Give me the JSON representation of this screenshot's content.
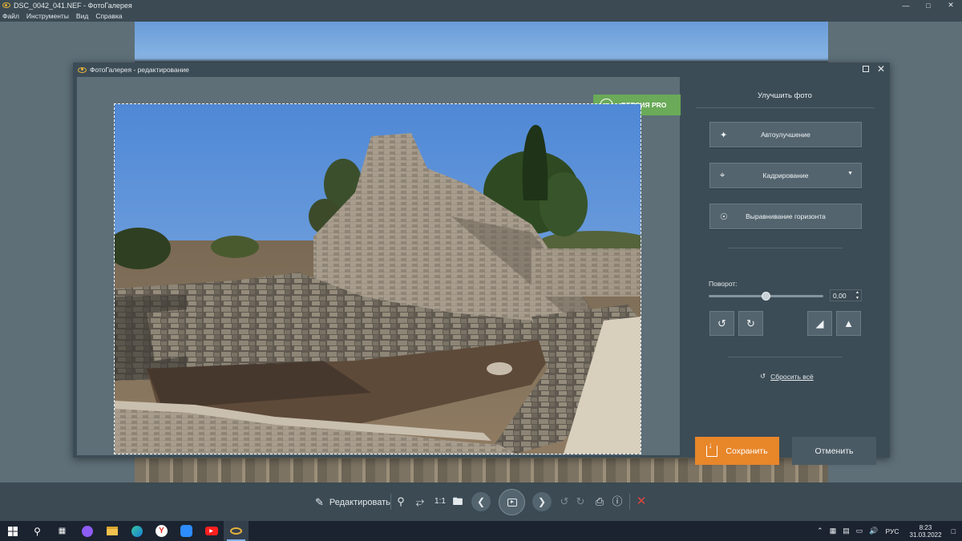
{
  "window": {
    "title": "DSC_0042_041.NEF - ФотоГалерея",
    "menu": [
      "Файл",
      "Инструменты",
      "Вид",
      "Справка"
    ]
  },
  "dialog": {
    "title": "ФотоГалерея - редактирование",
    "pro_badge": "ВЕРСИЯ PRO"
  },
  "panel": {
    "title": "Улучшить фото",
    "auto_enhance": "Автоулучшение",
    "crop": "Кадрирование",
    "horizon": "Выравнивание горизонта",
    "rotation_label": "Поворот:",
    "rotation_value": "0,00",
    "rotation_slider_fraction": 0.5,
    "reset_label": "Сбросить всё",
    "save_label": "Сохранить",
    "cancel_label": "Отменить"
  },
  "toolbar": {
    "edit_label": "Редактировать",
    "zoom_1to1": "1:1"
  },
  "taskbar": {
    "lang": "РУС",
    "time": "8:23",
    "date": "31.03.2022"
  },
  "colors": {
    "accent_save": "#e8862a",
    "pro_green": "#6aaa58",
    "close_red": "#e0443c"
  }
}
